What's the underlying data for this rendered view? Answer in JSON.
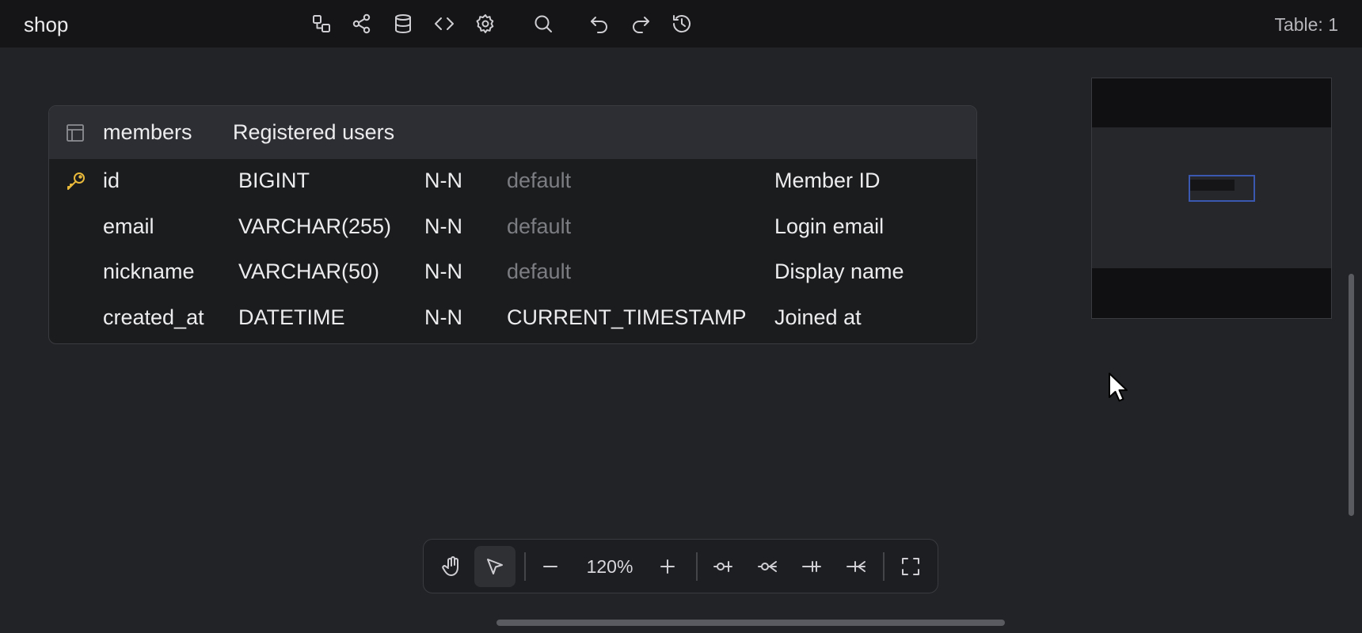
{
  "app": {
    "title": "shop",
    "table_count": "Table: 1"
  },
  "toolbar_icons": [
    "diagram-icon",
    "share-icon",
    "database-icon",
    "code-icon",
    "settings-icon",
    "search-icon",
    "undo-icon",
    "redo-icon",
    "history-icon"
  ],
  "table": {
    "name": "members",
    "comment": "Registered users",
    "columns": [
      {
        "primary_key": true,
        "name": "id",
        "type": "BIGINT",
        "nullable": "N-N",
        "default": "default",
        "default_is_placeholder": true,
        "comment": "Member ID"
      },
      {
        "primary_key": false,
        "name": "email",
        "type": "VARCHAR(255)",
        "nullable": "N-N",
        "default": "default",
        "default_is_placeholder": true,
        "comment": "Login email"
      },
      {
        "primary_key": false,
        "name": "nickname",
        "type": "VARCHAR(50)",
        "nullable": "N-N",
        "default": "default",
        "default_is_placeholder": true,
        "comment": "Display name"
      },
      {
        "primary_key": false,
        "name": "created_at",
        "type": "DATETIME",
        "nullable": "N-N",
        "default": "CURRENT_TIMESTAMP",
        "default_is_placeholder": false,
        "comment": "Joined at"
      }
    ]
  },
  "bottom_toolbar": {
    "zoom": "120%",
    "active_tool": "select",
    "icons": [
      "hand-icon",
      "pointer-icon",
      "zoom-out-icon",
      "zoom-in-icon",
      "relation-zero-one-icon",
      "relation-zero-many-icon",
      "relation-one-one-icon",
      "relation-one-many-icon",
      "fullscreen-icon"
    ]
  },
  "colors": {
    "accent": "#3a58b0",
    "key": "#e8b93a",
    "background": "#222326"
  }
}
